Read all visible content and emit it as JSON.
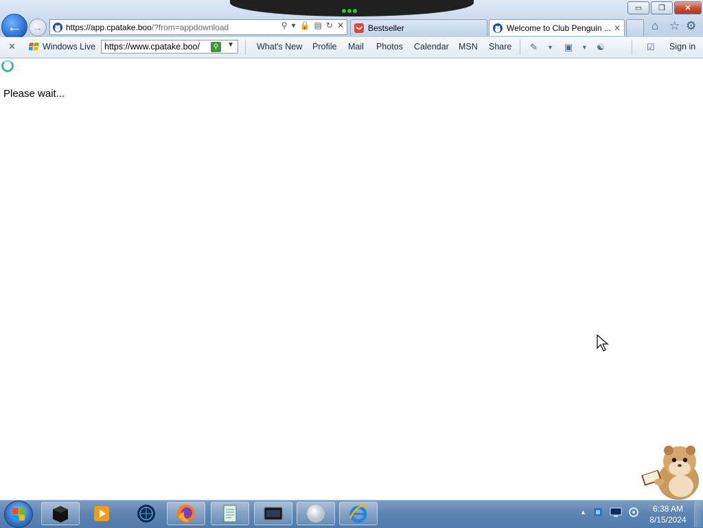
{
  "window": {
    "minimize": "▭",
    "restore": "❐",
    "close": "✕"
  },
  "nav": {
    "back_icon": "arrow-left-icon",
    "forward_icon": "arrow-right-icon"
  },
  "address_bar": {
    "url_host": "https://app.cpatake.boo",
    "url_rest": "/?from=appdownload",
    "tools": [
      "search-icon",
      "dropdown-icon",
      "lock-icon",
      "compat-icon",
      "refresh-icon",
      "stop-icon"
    ]
  },
  "tabs": [
    {
      "label": "Bestseller",
      "icon": "bestseller-icon"
    },
    {
      "label": "Welcome to Club Penguin ...",
      "icon": "penguin-icon",
      "close": "✕"
    }
  ],
  "right_icons": [
    "home-icon",
    "favorites-star-icon",
    "gear-icon"
  ],
  "toolbar": {
    "close": "✕",
    "windows_live": "Windows Live",
    "search_value": "https://www.cpatake.boo/",
    "links": [
      "What's New",
      "Profile",
      "Mail",
      "Photos",
      "Calendar",
      "MSN",
      "Share"
    ],
    "sign_in": "Sign in"
  },
  "page": {
    "message": "Please wait..."
  },
  "taskbar": {
    "apps": [
      "cube-app-icon",
      "media-player-icon",
      "globe-app-icon",
      "firefox-icon",
      "notepad-icon",
      "terminal-icon",
      "sphere-app-icon",
      "internet-explorer-icon"
    ],
    "tray": [
      "show-hidden-icon",
      "network-app-icon",
      "monitor-icon",
      "volume-icon"
    ],
    "time": "6:38 AM",
    "date": "8/15/2024"
  },
  "colors": {
    "accent": "#1e66c9",
    "taskbar": "#5f86b3",
    "close_red": "#c94a33"
  }
}
